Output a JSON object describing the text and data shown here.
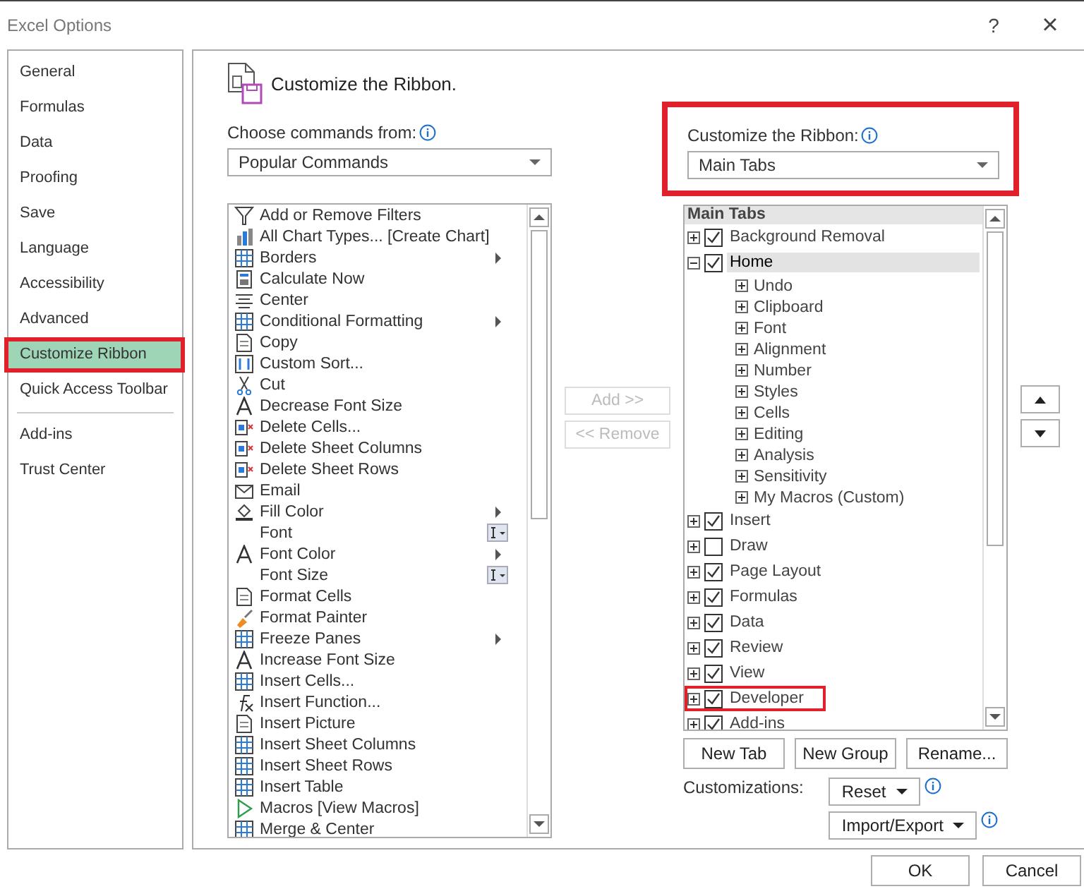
{
  "window": {
    "title": "Excel Options",
    "help": "?",
    "close": "×"
  },
  "sidebar": {
    "items": [
      {
        "label": "General",
        "selected": false,
        "highlighted": false
      },
      {
        "label": "Formulas",
        "selected": false,
        "highlighted": false
      },
      {
        "label": "Data",
        "selected": false,
        "highlighted": false
      },
      {
        "label": "Proofing",
        "selected": false,
        "highlighted": false
      },
      {
        "label": "Save",
        "selected": false,
        "highlighted": false
      },
      {
        "label": "Language",
        "selected": false,
        "highlighted": false
      },
      {
        "label": "Accessibility",
        "selected": false,
        "highlighted": false
      },
      {
        "label": "Advanced",
        "selected": false,
        "highlighted": false
      },
      {
        "label": "Customize Ribbon",
        "selected": true,
        "highlighted": true
      },
      {
        "label": "Quick Access Toolbar",
        "selected": false,
        "highlighted": false
      },
      {
        "label": "Add-ins",
        "selected": false,
        "highlighted": false,
        "separator_before": true
      },
      {
        "label": "Trust Center",
        "selected": false,
        "highlighted": false
      }
    ]
  },
  "heading": "Customize the Ribbon.",
  "commands": {
    "label": "Choose commands from:",
    "dropdown": "Popular Commands",
    "items": [
      {
        "label": "Add or Remove Filters"
      },
      {
        "label": "All Chart Types... [Create Chart]"
      },
      {
        "label": "Borders",
        "kind": "submenu"
      },
      {
        "label": "Calculate Now"
      },
      {
        "label": "Center"
      },
      {
        "label": "Conditional Formatting",
        "kind": "submenu"
      },
      {
        "label": "Copy"
      },
      {
        "label": "Custom Sort..."
      },
      {
        "label": "Cut"
      },
      {
        "label": "Decrease Font Size"
      },
      {
        "label": "Delete Cells..."
      },
      {
        "label": "Delete Sheet Columns"
      },
      {
        "label": "Delete Sheet Rows"
      },
      {
        "label": "Email"
      },
      {
        "label": "Fill Color",
        "kind": "submenu"
      },
      {
        "label": "Font",
        "kind": "font"
      },
      {
        "label": "Font Color",
        "kind": "submenu"
      },
      {
        "label": "Font Size",
        "kind": "font"
      },
      {
        "label": "Format Cells"
      },
      {
        "label": "Format Painter"
      },
      {
        "label": "Freeze Panes",
        "kind": "submenu"
      },
      {
        "label": "Increase Font Size"
      },
      {
        "label": "Insert Cells..."
      },
      {
        "label": "Insert Function..."
      },
      {
        "label": "Insert Picture"
      },
      {
        "label": "Insert Sheet Columns"
      },
      {
        "label": "Insert Sheet Rows"
      },
      {
        "label": "Insert Table"
      },
      {
        "label": "Macros [View Macros]"
      },
      {
        "label": "Merge & Center"
      }
    ]
  },
  "add_button": {
    "label": "Add >>",
    "disabled": true
  },
  "remove_button": {
    "label": "<< Remove",
    "disabled": true
  },
  "ribbon": {
    "label": "Customize the Ribbon:",
    "dropdown": "Main Tabs",
    "highlighted": true,
    "tree_header": "Main Tabs",
    "tabs": [
      {
        "label": "Background Removal",
        "checked": true,
        "expanded": false,
        "selected": false,
        "highlighted": false
      },
      {
        "label": "Home",
        "checked": true,
        "expanded": true,
        "selected": true,
        "highlighted": false,
        "children": [
          {
            "label": "Undo"
          },
          {
            "label": "Clipboard"
          },
          {
            "label": "Font"
          },
          {
            "label": "Alignment"
          },
          {
            "label": "Number"
          },
          {
            "label": "Styles"
          },
          {
            "label": "Cells"
          },
          {
            "label": "Editing"
          },
          {
            "label": "Analysis"
          },
          {
            "label": "Sensitivity"
          },
          {
            "label": "My Macros (Custom)"
          }
        ]
      },
      {
        "label": "Insert",
        "checked": true,
        "expanded": false,
        "selected": false,
        "highlighted": false
      },
      {
        "label": "Draw",
        "checked": false,
        "expanded": false,
        "selected": false,
        "highlighted": false
      },
      {
        "label": "Page Layout",
        "checked": true,
        "expanded": false,
        "selected": false,
        "highlighted": false
      },
      {
        "label": "Formulas",
        "checked": true,
        "expanded": false,
        "selected": false,
        "highlighted": false
      },
      {
        "label": "Data",
        "checked": true,
        "expanded": false,
        "selected": false,
        "highlighted": false
      },
      {
        "label": "Review",
        "checked": true,
        "expanded": false,
        "selected": false,
        "highlighted": false
      },
      {
        "label": "View",
        "checked": true,
        "expanded": false,
        "selected": false,
        "highlighted": false
      },
      {
        "label": "Developer",
        "checked": true,
        "expanded": false,
        "selected": false,
        "highlighted": true
      },
      {
        "label": "Add-ins",
        "checked": true,
        "expanded": false,
        "selected": false,
        "highlighted": false
      }
    ]
  },
  "tab_buttons": [
    "New Tab",
    "New Group",
    "Rename..."
  ],
  "customizations": {
    "label": "Customizations:",
    "reset": "Reset",
    "import_export": "Import/Export"
  },
  "footer": {
    "buttons": [
      "OK",
      "Cancel"
    ]
  }
}
